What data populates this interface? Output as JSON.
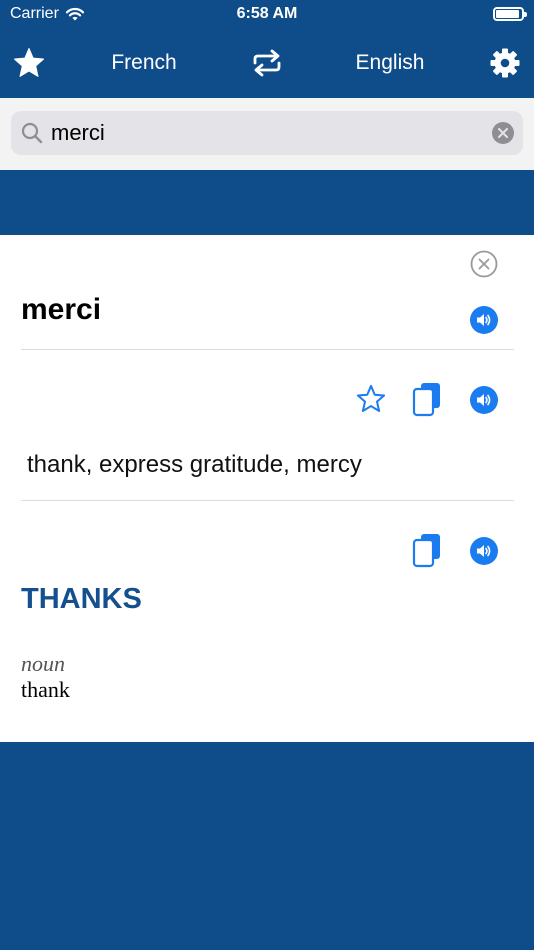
{
  "status_bar": {
    "carrier": "Carrier",
    "time": "6:58 AM"
  },
  "nav": {
    "source_language": "French",
    "target_language": "English",
    "favorites_icon": "star-icon",
    "swap_icon": "swap-icon",
    "settings_icon": "gear-icon"
  },
  "search": {
    "value": "merci",
    "placeholder": ""
  },
  "entry": {
    "headword": "merci",
    "translation": "thank, express gratitude, mercy",
    "heading": "THANKS",
    "part_of_speech": "noun",
    "sense": "thank"
  },
  "colors": {
    "primary": "#0f4c8a",
    "accent": "#1b7cf0",
    "heading": "#13508d"
  }
}
